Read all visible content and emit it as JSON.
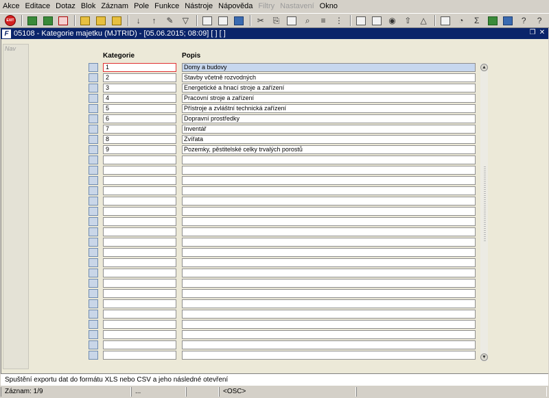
{
  "menu": [
    {
      "label": "Akce",
      "disabled": false
    },
    {
      "label": "Editace",
      "disabled": false
    },
    {
      "label": "Dotaz",
      "disabled": false
    },
    {
      "label": "Blok",
      "disabled": false
    },
    {
      "label": "Záznam",
      "disabled": false
    },
    {
      "label": "Pole",
      "disabled": false
    },
    {
      "label": "Funkce",
      "disabled": false
    },
    {
      "label": "Nástroje",
      "disabled": false
    },
    {
      "label": "Nápověda",
      "disabled": false
    },
    {
      "label": "Filtry",
      "disabled": true
    },
    {
      "label": "Nastavení",
      "disabled": true
    },
    {
      "label": "Okno",
      "disabled": false
    }
  ],
  "toolbar": {
    "exit_text": "EXIT",
    "icons": [
      "exit-icon",
      "save-icon",
      "save-green-icon",
      "delete-icon",
      "query-icon",
      "query-execute-icon",
      "query-cancel-icon",
      "sort-asc-icon",
      "sort-desc-icon",
      "tools-icon",
      "filter-icon",
      "print-icon",
      "print-preview-icon",
      "export-icon",
      "cut-icon",
      "copy-icon",
      "paste-icon",
      "find-icon",
      "list-icon",
      "tree-icon",
      "calc-icon",
      "attach-icon",
      "globe-icon",
      "upload-icon",
      "warning-icon",
      "chart-icon",
      "clock-icon",
      "sum-icon",
      "excel-icon",
      "world-icon",
      "help-icon",
      "context-help-icon"
    ]
  },
  "window": {
    "title": "05108 - Kategorie majetku (MJTRID) - [05.06.2015; 08:09]  [ ]  [ ]",
    "icon_letter": "F"
  },
  "nav_label": "Nav",
  "grid": {
    "col_kategorie": "Kategorie",
    "col_popis": "Popis",
    "rows": [
      {
        "kategorie": "1",
        "popis": "Domy a budovy"
      },
      {
        "kategorie": "2",
        "popis": "Stavby včetně rozvodných"
      },
      {
        "kategorie": "3",
        "popis": "Energetické a hnací stroje a zařízení"
      },
      {
        "kategorie": "4",
        "popis": "Pracovní stroje a zařízení"
      },
      {
        "kategorie": "5",
        "popis": "Přístroje a zvláštní technická zařízení"
      },
      {
        "kategorie": "6",
        "popis": "Dopravní prostředky"
      },
      {
        "kategorie": "7",
        "popis": "Inventář"
      },
      {
        "kategorie": "8",
        "popis": "Zvířata"
      },
      {
        "kategorie": "9",
        "popis": "Pozemky, pěstitelské celky trvalých porostů"
      },
      {
        "kategorie": "",
        "popis": ""
      },
      {
        "kategorie": "",
        "popis": ""
      },
      {
        "kategorie": "",
        "popis": ""
      },
      {
        "kategorie": "",
        "popis": ""
      },
      {
        "kategorie": "",
        "popis": ""
      },
      {
        "kategorie": "",
        "popis": ""
      },
      {
        "kategorie": "",
        "popis": ""
      },
      {
        "kategorie": "",
        "popis": ""
      },
      {
        "kategorie": "",
        "popis": ""
      },
      {
        "kategorie": "",
        "popis": ""
      },
      {
        "kategorie": "",
        "popis": ""
      },
      {
        "kategorie": "",
        "popis": ""
      },
      {
        "kategorie": "",
        "popis": ""
      },
      {
        "kategorie": "",
        "popis": ""
      },
      {
        "kategorie": "",
        "popis": ""
      },
      {
        "kategorie": "",
        "popis": ""
      },
      {
        "kategorie": "",
        "popis": ""
      },
      {
        "kategorie": "",
        "popis": ""
      },
      {
        "kategorie": "",
        "popis": ""
      },
      {
        "kategorie": "",
        "popis": ""
      }
    ],
    "current_row": 0
  },
  "status_message": "Spuštění exportu dat do formátu XLS nebo CSV a jeho následné otevření",
  "statusbar": {
    "record": "Záznam: 1/9",
    "seg2": "...",
    "seg3": "",
    "seg4": "<OSC>",
    "seg5": ""
  }
}
